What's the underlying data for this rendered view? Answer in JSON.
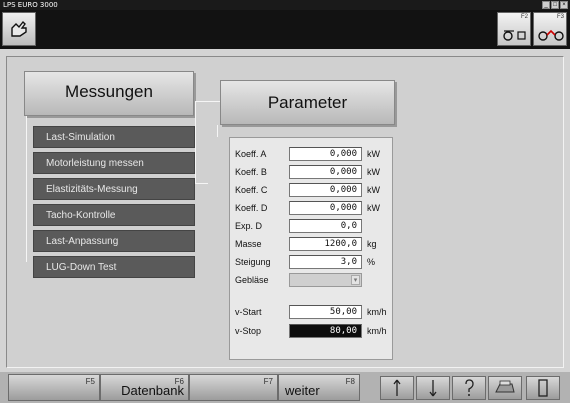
{
  "window": {
    "title": "LPS EURO 3000"
  },
  "toolbar": {
    "f2_key": "F2",
    "f3_key": "F3"
  },
  "left_panel": {
    "title": "Messungen",
    "items": [
      {
        "label": "Last-Simulation"
      },
      {
        "label": "Motorleistung messen"
      },
      {
        "label": "Elastizitäts-Messung"
      },
      {
        "label": "Tacho-Kontrolle"
      },
      {
        "label": "Last-Anpassung"
      },
      {
        "label": "LUG-Down Test"
      }
    ]
  },
  "parameter": {
    "title": "Parameter",
    "fields": [
      {
        "label": "Koeff. A",
        "value": "0,000",
        "unit": "kW"
      },
      {
        "label": "Koeff. B",
        "value": "0,000",
        "unit": "kW"
      },
      {
        "label": "Koeff. C",
        "value": "0,000",
        "unit": "kW"
      },
      {
        "label": "Koeff. D",
        "value": "0,000",
        "unit": "kW"
      },
      {
        "label": "Exp. D",
        "value": "0,0",
        "unit": ""
      },
      {
        "label": "Masse",
        "value": "1200,0",
        "unit": "kg"
      },
      {
        "label": "Steigung",
        "value": "3,0",
        "unit": "%"
      }
    ],
    "geblaese": {
      "label": "Gebläse",
      "value": ""
    },
    "speed_fields": [
      {
        "label": "v-Start",
        "value": "50,00",
        "unit": "km/h"
      },
      {
        "label": "v-Stop",
        "value": "80,00",
        "unit": "km/h"
      }
    ]
  },
  "bottom": {
    "keys": [
      {
        "fkey": "F5",
        "label": ""
      },
      {
        "fkey": "F6",
        "label": "Datenbank"
      },
      {
        "fkey": "F7",
        "label": ""
      },
      {
        "fkey": "F8",
        "label": "weiter"
      }
    ],
    "icons": [
      "arrow-up-icon",
      "arrow-down-icon",
      "help-icon",
      "printer-icon",
      "exit-door-icon"
    ]
  }
}
